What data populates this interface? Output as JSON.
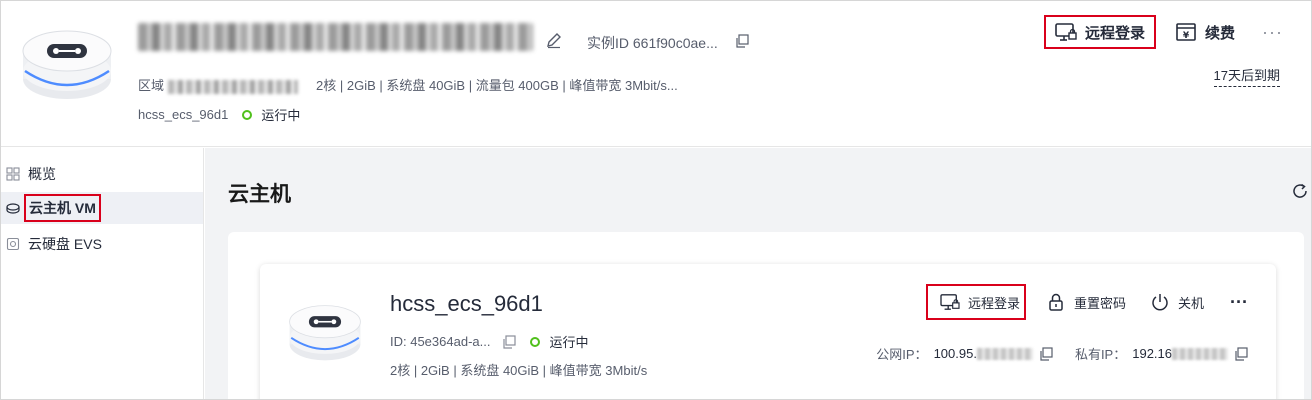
{
  "header": {
    "instance_id_label": "实例ID 661f90c0ae...",
    "region_label": "区域",
    "specs": "2核 | 2GiB | 系统盘 40GiB | 流量包 400GB | 峰值带宽 3Mbit/s...",
    "hostname": "hcss_ecs_96d1",
    "status": "运行中",
    "remote_login_label": "远程登录",
    "renew_label": "续费",
    "more_label": "···",
    "expire_text": "17天后到期"
  },
  "sidebar": {
    "items": [
      {
        "label": "概览",
        "icon": "grid-icon"
      },
      {
        "label": "云主机 VM",
        "icon": "server-icon"
      },
      {
        "label": "云硬盘 EVS",
        "icon": "disk-icon"
      }
    ]
  },
  "main": {
    "title": "云主机",
    "card": {
      "name": "hcss_ecs_96d1",
      "id_label": "ID: 45e364ad-a...",
      "status": "运行中",
      "specs": "2核 | 2GiB | 系统盘 40GiB | 峰值带宽 3Mbit/s",
      "actions": {
        "remote_login": "远程登录",
        "reset_password": "重置密码",
        "shutdown": "关机",
        "more": "···"
      },
      "public_ip_label": "公网IP：",
      "public_ip_value": "100.95.",
      "private_ip_label": "私有IP：",
      "private_ip_value": "192.16"
    }
  },
  "colors": {
    "highlight": "#d9001b",
    "status_green": "#50c01c",
    "accent_blue": "#5b8ff9"
  }
}
